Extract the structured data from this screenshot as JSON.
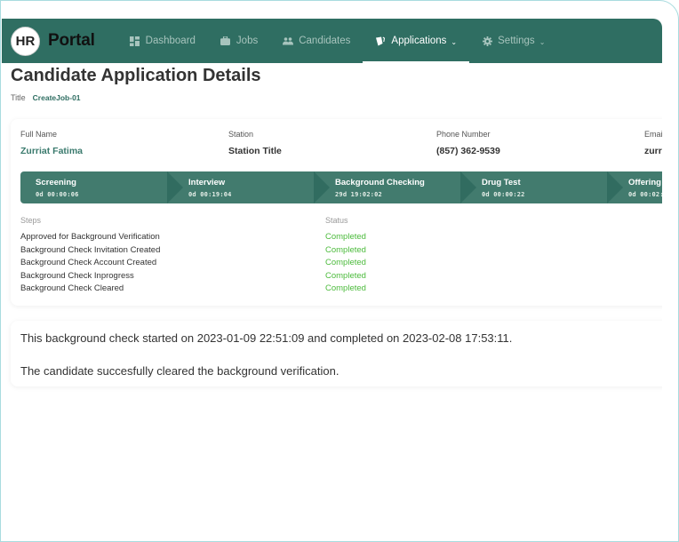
{
  "nav": {
    "logo_badge": "HR",
    "logo_text": "Portal",
    "items": [
      {
        "label": "Dashboard",
        "icon": "dashboard-icon",
        "active": false,
        "has_dropdown": false
      },
      {
        "label": "Jobs",
        "icon": "briefcase-icon",
        "active": false,
        "has_dropdown": false
      },
      {
        "label": "Candidates",
        "icon": "users-icon",
        "active": false,
        "has_dropdown": false
      },
      {
        "label": "Applications",
        "icon": "applications-icon",
        "active": true,
        "has_dropdown": true
      },
      {
        "label": "Settings",
        "icon": "gear-icon",
        "active": false,
        "has_dropdown": true
      }
    ],
    "dropdown_glyph": "⌄"
  },
  "page": {
    "title": "Candidate Application Details",
    "subtitle_label": "Title",
    "subtitle_value": "CreateJob-01"
  },
  "candidate": {
    "fields": [
      {
        "label": "Full Name",
        "value": "Zurriat Fatima"
      },
      {
        "label": "Station",
        "value": "Station Title"
      },
      {
        "label": "Phone Number",
        "value": "(857) 362-9539"
      },
      {
        "label": "Email",
        "value": "zurr"
      }
    ]
  },
  "pipeline": {
    "stages": [
      {
        "name": "Screening",
        "duration": "0d 00:00:06"
      },
      {
        "name": "Interview",
        "duration": "0d 00:19:04"
      },
      {
        "name": "Background Checking",
        "duration": "29d 19:02:02"
      },
      {
        "name": "Drug Test",
        "duration": "0d 00:00:22"
      },
      {
        "name": "Offering",
        "duration": "0d 00:02:"
      }
    ]
  },
  "steps": {
    "steps_header": "Steps",
    "status_header": "Status",
    "rows": [
      {
        "step": "Approved for Background Verification",
        "status": "Completed"
      },
      {
        "step": "Background Check Invitation Created",
        "status": "Completed"
      },
      {
        "step": "Background Check Account Created",
        "status": "Completed"
      },
      {
        "step": "Background Check Inprogress",
        "status": "Completed"
      },
      {
        "step": "Background Check Cleared",
        "status": "Completed"
      }
    ]
  },
  "summary": {
    "line1": "This background check started on 2023-01-09 22:51:09 and completed on 2023-02-08 17:53:11.",
    "line2": "The candidate succesfully cleared the background verification."
  },
  "colors": {
    "brand": "#2f6e62",
    "pipeline": "#427b6e",
    "status_completed": "#4cbb3c"
  }
}
